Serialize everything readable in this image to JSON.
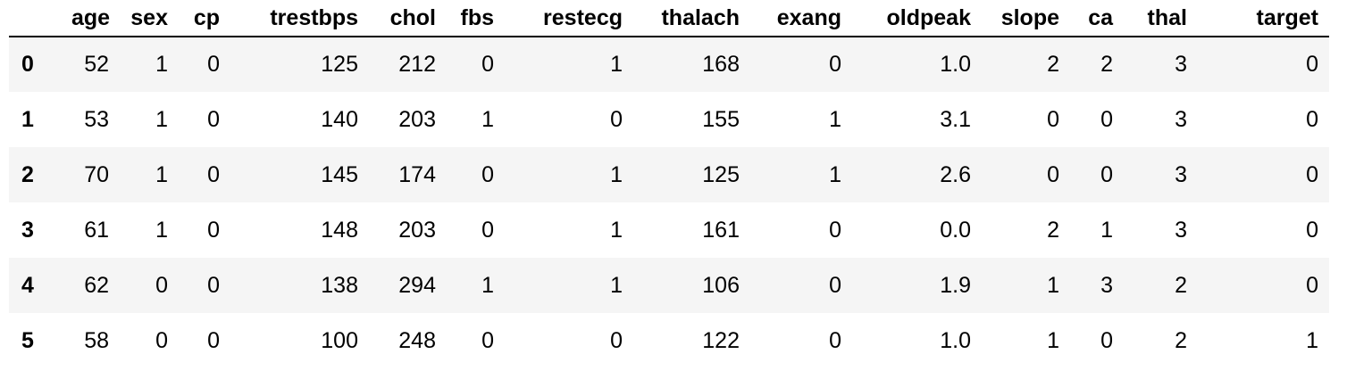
{
  "dataframe": {
    "index_header": "",
    "columns": [
      "age",
      "sex",
      "cp",
      "trestbps",
      "chol",
      "fbs",
      "restecg",
      "thalach",
      "exang",
      "oldpeak",
      "slope",
      "ca",
      "thal",
      "target"
    ],
    "rows": [
      {
        "index": "0",
        "values": [
          "52",
          "1",
          "0",
          "125",
          "212",
          "0",
          "1",
          "168",
          "0",
          "1.0",
          "2",
          "2",
          "3",
          "0"
        ]
      },
      {
        "index": "1",
        "values": [
          "53",
          "1",
          "0",
          "140",
          "203",
          "1",
          "0",
          "155",
          "1",
          "3.1",
          "0",
          "0",
          "3",
          "0"
        ]
      },
      {
        "index": "2",
        "values": [
          "70",
          "1",
          "0",
          "145",
          "174",
          "0",
          "1",
          "125",
          "1",
          "2.6",
          "0",
          "0",
          "3",
          "0"
        ]
      },
      {
        "index": "3",
        "values": [
          "61",
          "1",
          "0",
          "148",
          "203",
          "0",
          "1",
          "161",
          "0",
          "0.0",
          "2",
          "1",
          "3",
          "0"
        ]
      },
      {
        "index": "4",
        "values": [
          "62",
          "0",
          "0",
          "138",
          "294",
          "1",
          "1",
          "106",
          "0",
          "1.9",
          "1",
          "3",
          "2",
          "0"
        ]
      },
      {
        "index": "5",
        "values": [
          "58",
          "0",
          "0",
          "100",
          "248",
          "0",
          "0",
          "122",
          "0",
          "1.0",
          "1",
          "0",
          "2",
          "1"
        ]
      }
    ]
  },
  "colors": {
    "text": "#000000",
    "stripe": "#f5f5f5",
    "background": "#ffffff",
    "header_rule": "#000000"
  }
}
